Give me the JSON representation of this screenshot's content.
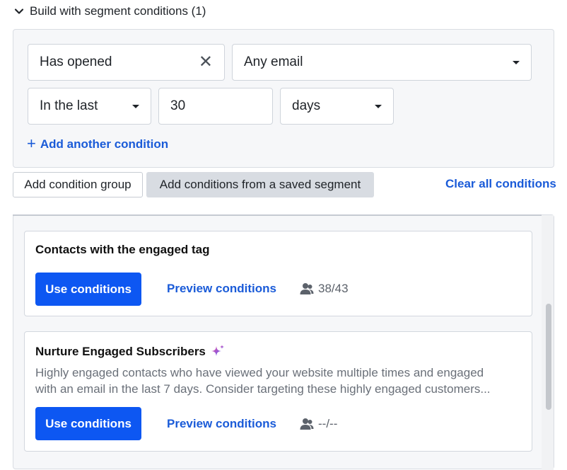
{
  "header": {
    "title": "Build with segment conditions (1)"
  },
  "condition": {
    "action_value": "Has opened",
    "email_select": "Any email",
    "timeframe_select": "In the last",
    "amount_value": "30",
    "unit_select": "days",
    "add_condition_label": "Add another condition"
  },
  "actions": {
    "add_group_label": "Add condition group",
    "add_saved_label": "Add conditions from a saved segment",
    "clear_all_label": "Clear all conditions"
  },
  "saved_segments": [
    {
      "title": "Contacts with the engaged tag",
      "use_label": "Use conditions",
      "preview_label": "Preview conditions",
      "count": "38/43"
    },
    {
      "title": "Nurture Engaged Subscribers",
      "description_line1": "Highly engaged contacts who have viewed your website multiple times and engaged",
      "description_line2": "with an email in the last 7 days. Consider targeting these highly engaged customers...",
      "use_label": "Use conditions",
      "preview_label": "Preview conditions",
      "count": "--/--"
    }
  ],
  "colors": {
    "primary": "#0d57f2",
    "link": "#1a5bd8",
    "sparkle_start": "#ef4fa3",
    "sparkle_end": "#5b5cf6"
  },
  "icons": {
    "collapse": "chevron-down-icon",
    "clear": "close-icon",
    "add": "plus-icon",
    "ai": "sparkle-icon",
    "contacts": "people-icon"
  }
}
